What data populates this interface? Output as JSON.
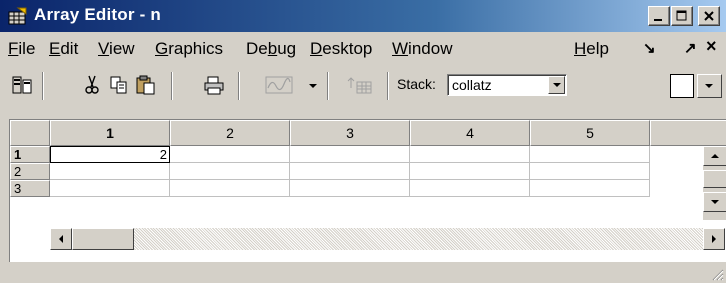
{
  "window": {
    "title": "Array Editor - n"
  },
  "menu": {
    "items": [
      {
        "label": "File",
        "mnemonic": "F",
        "rest": "ile"
      },
      {
        "label": "Edit",
        "mnemonic": "E",
        "rest": "dit"
      },
      {
        "label": "View",
        "mnemonic": "V",
        "rest": "iew"
      },
      {
        "label": "Graphics",
        "mnemonic": "G",
        "rest": "raphics"
      },
      {
        "label": "Debug",
        "pre": "De",
        "mnemonic": "b",
        "rest": "ug"
      },
      {
        "label": "Desktop",
        "mnemonic": "D",
        "rest": "esktop"
      },
      {
        "label": "Window",
        "mnemonic": "W",
        "rest": "indow"
      },
      {
        "label": "Help",
        "mnemonic": "H",
        "rest": "elp"
      }
    ],
    "dock_glyph": "↘",
    "undock_glyph": "↗",
    "close_glyph": "×"
  },
  "toolbar": {
    "stack_label": "Stack:",
    "stack_value": "collatz",
    "icons": [
      "import-data-icon",
      "cut-icon",
      "copy-icon",
      "paste-icon",
      "print-icon",
      "plot-icon",
      "insert-variable-icon"
    ]
  },
  "grid": {
    "columns": [
      "1",
      "2",
      "3",
      "4",
      "5"
    ],
    "rows": [
      "1",
      "2",
      "3"
    ],
    "cells": [
      [
        "2",
        "",
        "",
        "",
        ""
      ],
      [
        "",
        "",
        "",
        "",
        ""
      ],
      [
        "",
        "",
        "",
        "",
        ""
      ]
    ],
    "selected_row": "1",
    "selected_col": "1"
  },
  "colors": {
    "title_start": "#0a246a",
    "title_end": "#a6caf0",
    "face": "#d4d0c8"
  }
}
